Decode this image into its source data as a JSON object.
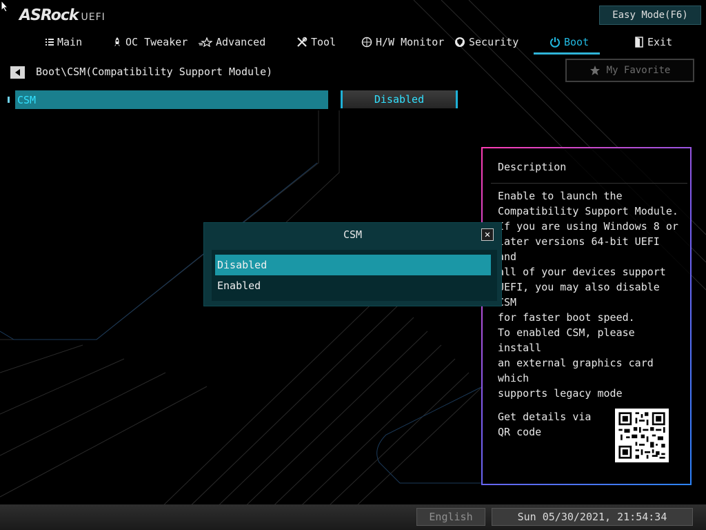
{
  "header": {
    "logo_text": "ASRock",
    "logo_sub": "UEFI",
    "easy_mode_label": "Easy Mode(F6)"
  },
  "nav": {
    "tabs": [
      {
        "label": "Main",
        "icon": "list-icon"
      },
      {
        "label": "OC Tweaker",
        "icon": "rocket-icon"
      },
      {
        "label": "Advanced",
        "icon": "star-icon"
      },
      {
        "label": "Tool",
        "icon": "tools-icon"
      },
      {
        "label": "H/W Monitor",
        "icon": "monitor-icon"
      },
      {
        "label": "Security",
        "icon": "shield-icon"
      },
      {
        "label": "Boot",
        "icon": "power-icon",
        "active": true
      },
      {
        "label": "Exit",
        "icon": "exit-door-icon"
      }
    ]
  },
  "breadcrumb": "Boot\\CSM(Compatibility Support Module)",
  "favorite_label": "My Favorite",
  "settings": [
    {
      "label": "CSM",
      "value": "Disabled"
    }
  ],
  "description": {
    "title": "Description",
    "text": "Enable to launch the\nCompatibility Support Module.\nIf you are using Windows 8 or\nlater versions 64-bit UEFI and\nall of your devices support\nUEFI, you may also disable CSM\nfor faster boot speed.\nTo enabled CSM, please install\nan external graphics card which\nsupports legacy mode",
    "qr_label": "Get details via QR code"
  },
  "popup": {
    "title": "CSM",
    "options": [
      "Disabled",
      "Enabled"
    ],
    "selected": "Disabled"
  },
  "footer": {
    "language": "English",
    "datetime": "Sun 05/30/2021, 21:54:34"
  },
  "colors": {
    "accent": "#21b8e0",
    "highlight_row": "#1a7f8e",
    "popup_bg": "#0c363c",
    "popup_selected": "#1b97a6"
  }
}
